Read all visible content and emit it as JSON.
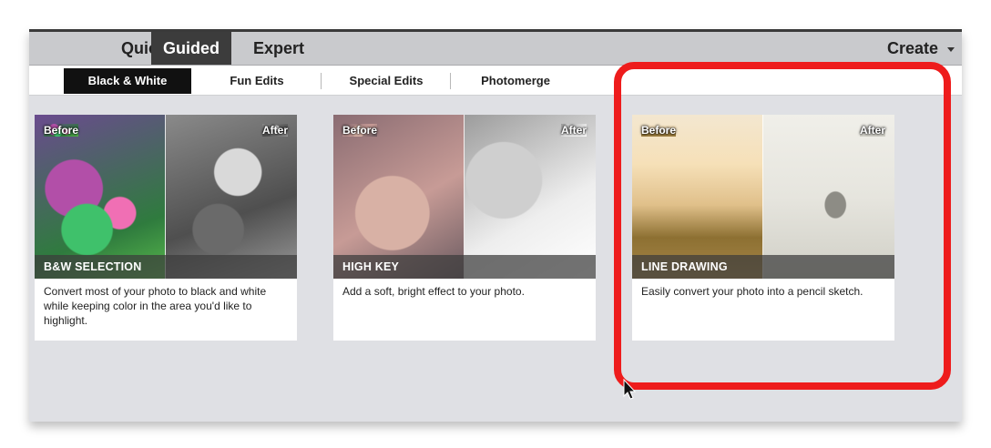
{
  "mode_tabs": [
    {
      "label": "Quick"
    },
    {
      "label": "Guided"
    },
    {
      "label": "Expert"
    }
  ],
  "create": {
    "label": "Create",
    "icon": "chevron-down-icon"
  },
  "sub_tabs": [
    {
      "label": "Black & White"
    },
    {
      "label": "Fun Edits"
    },
    {
      "label": "Special Edits"
    },
    {
      "label": "Photomerge"
    }
  ],
  "cards": [
    {
      "before": "Before",
      "after": "After",
      "title": "B&W SELECTION",
      "description": "Convert most of your photo to black and white while keeping color in the area you'd like to highlight."
    },
    {
      "before": "Before",
      "after": "After",
      "title": "HIGH KEY",
      "description": "Add a soft, bright effect to your photo."
    },
    {
      "before": "Before",
      "after": "After",
      "title": "LINE DRAWING",
      "description": "Easily convert your photo into a pencil sketch."
    }
  ],
  "highlight_color": "#ee1c1c",
  "active_tab_color": "#3c3c3c"
}
